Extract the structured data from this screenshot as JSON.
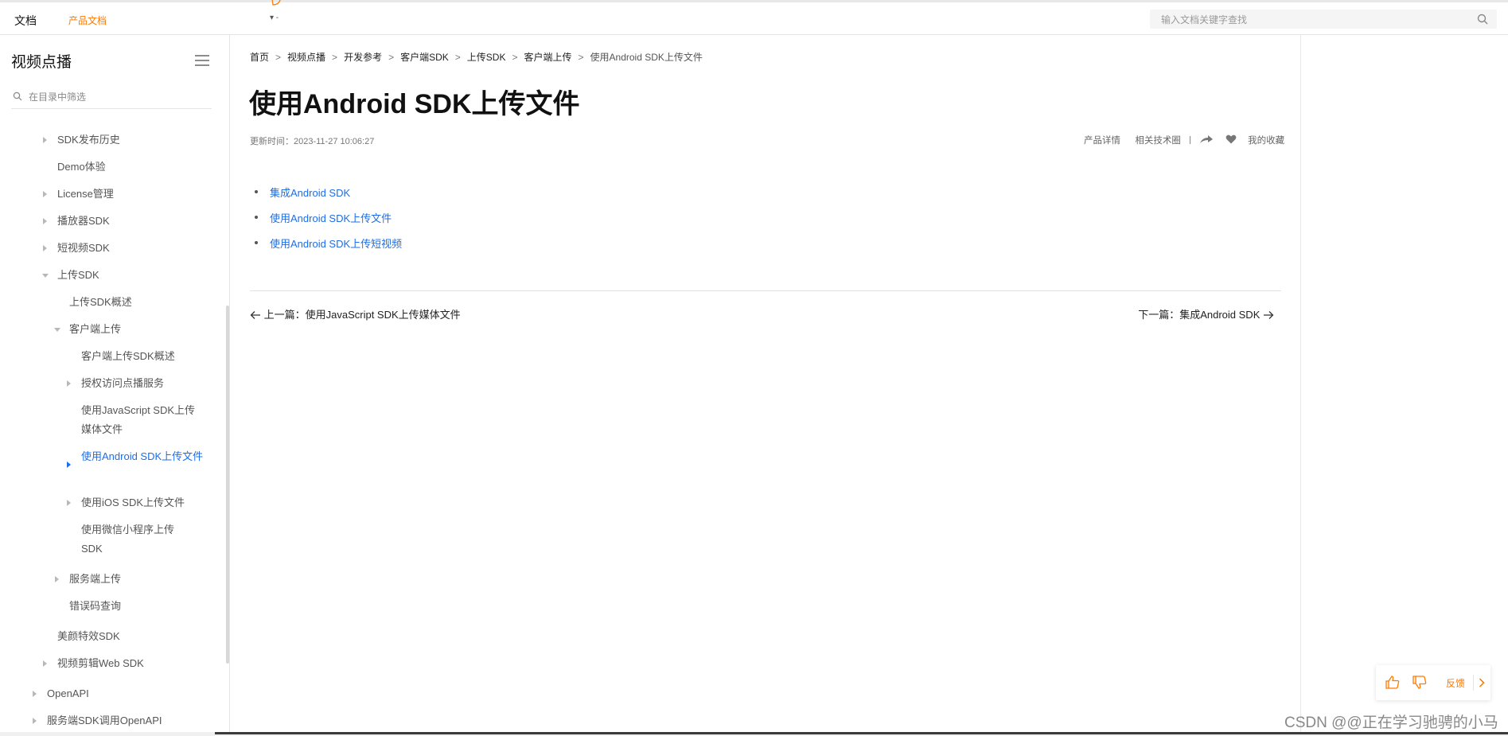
{
  "header": {
    "brand": "文档",
    "product_link": "产品文档",
    "dropdown_text": "▾ -",
    "search_placeholder": "输入文档关键字查找"
  },
  "sidebar": {
    "title": "视频点播",
    "filter_placeholder": "在目录中筛选",
    "items": [
      {
        "label": "SDK发布历史"
      },
      {
        "label": "Demo体验"
      },
      {
        "label": "License管理"
      },
      {
        "label": "播放器SDK"
      },
      {
        "label": "短视频SDK"
      },
      {
        "label": "上传SDK"
      },
      {
        "label": "上传SDK概述"
      },
      {
        "label": "客户端上传"
      },
      {
        "label": "客户端上传SDK概述"
      },
      {
        "label": "授权访问点播服务"
      },
      {
        "label": "使用JavaScript SDK上传媒体文件"
      },
      {
        "label": "使用Android SDK上传文件"
      },
      {
        "label": "使用iOS SDK上传文件"
      },
      {
        "label": "使用微信小程序上传SDK"
      },
      {
        "label": "服务端上传"
      },
      {
        "label": "错误码查询"
      },
      {
        "label": "美颜特效SDK"
      },
      {
        "label": "视频剪辑Web SDK"
      },
      {
        "label": "OpenAPI"
      },
      {
        "label": "服务端SDK调用OpenAPI"
      }
    ]
  },
  "breadcrumb": [
    "首页",
    "视频点播",
    "开发参考",
    "客户端SDK",
    "上传SDK",
    "客户端上传",
    "使用Android SDK上传文件"
  ],
  "page": {
    "title": "使用Android SDK上传文件",
    "update_time": "更新时间：2023-11-27 10:06:27",
    "meta": {
      "product_detail": "产品详情",
      "tech_circle": "相关技术圈",
      "favorite": "我的收藏"
    },
    "links": [
      "集成Android SDK",
      "使用Android SDK上传文件",
      "使用Android SDK上传短视频"
    ],
    "prev": "上一篇：使用JavaScript SDK上传媒体文件",
    "next": "下一篇：集成Android SDK"
  },
  "feedback": {
    "label": "反馈"
  },
  "watermark": "CSDN @@正在学习驰骋的小马",
  "colors": {
    "accent_orange": "#ff7800",
    "link_blue": "#1e6ee8"
  }
}
